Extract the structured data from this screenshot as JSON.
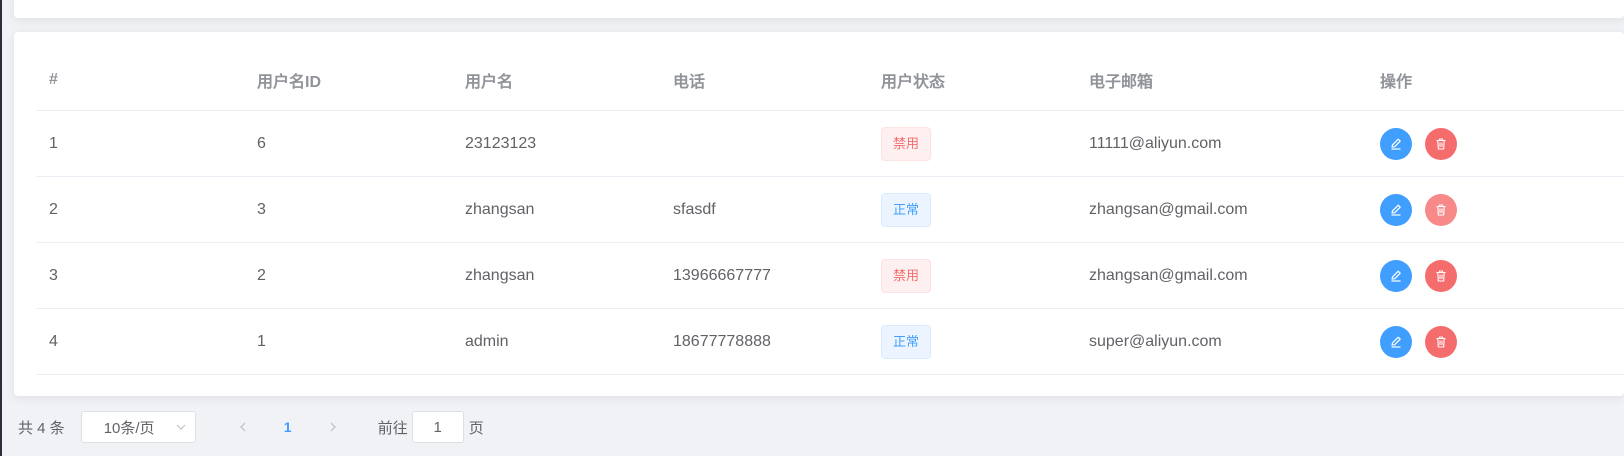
{
  "table": {
    "headers": [
      "#",
      "用户名ID",
      "用户名",
      "电话",
      "用户状态",
      "电子邮箱",
      "操作"
    ],
    "rows": [
      {
        "index": "1",
        "id": "6",
        "username": "23123123",
        "phone": "",
        "status": "禁用",
        "status_type": "disabled",
        "email": "11111@aliyun.com"
      },
      {
        "index": "2",
        "id": "3",
        "username": "zhangsan",
        "phone": "sfasdf",
        "status": "正常",
        "status_type": "normal",
        "email": "zhangsan@gmail.com"
      },
      {
        "index": "3",
        "id": "2",
        "username": "zhangsan",
        "phone": "13966667777",
        "status": "禁用",
        "status_type": "disabled",
        "email": "zhangsan@gmail.com"
      },
      {
        "index": "4",
        "id": "1",
        "username": "admin",
        "phone": "18677778888",
        "status": "正常",
        "status_type": "normal",
        "email": "super@aliyun.com"
      }
    ],
    "actions": {
      "edit_icon": "edit-icon",
      "delete_icon": "trash-icon"
    }
  },
  "pagination": {
    "total_label": "共 4 条",
    "page_size": "10条/页",
    "current_page": "1",
    "goto_prefix": "前往",
    "goto_value": "1",
    "goto_suffix": "页"
  },
  "colors": {
    "primary": "#409eff",
    "danger": "#f56c6c",
    "page_background": "#f0f2f5"
  }
}
